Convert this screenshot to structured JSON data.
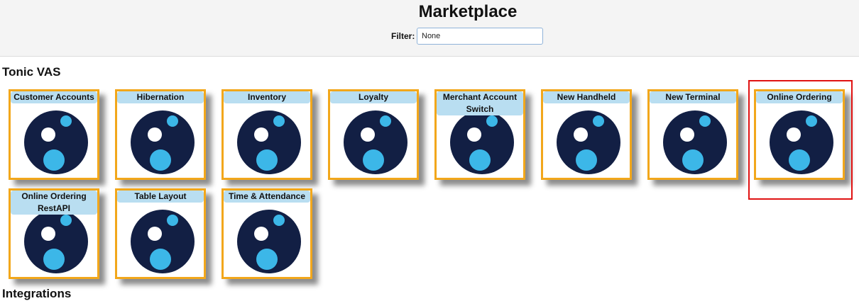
{
  "header": {
    "title": "Marketplace",
    "filter_label": "Filter:",
    "filter_value": "None"
  },
  "sections": [
    {
      "title": "Tonic VAS",
      "tiles": [
        {
          "label": "Customer Accounts"
        },
        {
          "label": "Hibernation"
        },
        {
          "label": "Inventory"
        },
        {
          "label": "Loyalty"
        },
        {
          "label": "Merchant Account Switch"
        },
        {
          "label": "New Handheld"
        },
        {
          "label": "New Terminal"
        },
        {
          "label": "Online Ordering"
        },
        {
          "label": "Online Ordering RestAPI"
        },
        {
          "label": "Table Layout"
        },
        {
          "label": "Time & Attendance"
        }
      ]
    },
    {
      "title": "Integrations"
    }
  ],
  "colors": {
    "tile_border": "#f2a71b",
    "label_bg": "#b9def1",
    "logo_dark": "#121f44",
    "logo_blue": "#3cb7e8",
    "highlight": "#e01212"
  },
  "icons": {
    "tile_logo": "tonic-logo-icon",
    "filter_dropdown": "chevron-down-icon"
  }
}
